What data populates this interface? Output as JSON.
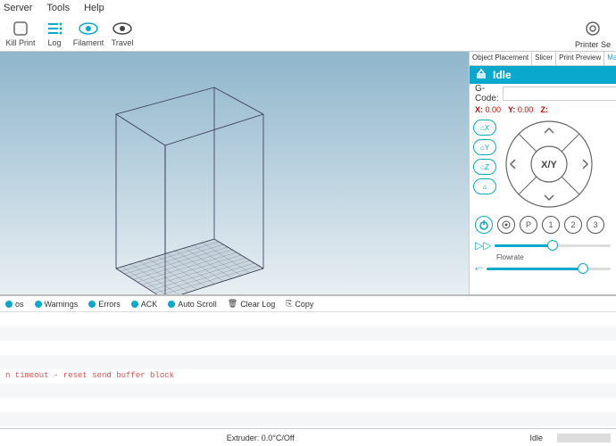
{
  "menu": {
    "items": [
      "Server",
      "Tools",
      "Help"
    ]
  },
  "toolbar": {
    "items": [
      {
        "name": "kill-print",
        "label": "Kill Print"
      },
      {
        "name": "log",
        "label": "Log"
      },
      {
        "name": "filament",
        "label": "Filament"
      },
      {
        "name": "travel",
        "label": "Travel"
      }
    ],
    "right": {
      "label": "Printer Se"
    }
  },
  "side": {
    "tabs": [
      "Object Placement",
      "Slicer",
      "Print Preview",
      "Manual C"
    ],
    "active_tab": 3,
    "status": "Idle",
    "gcode_label": "G-Code:",
    "gcode_value": "",
    "coords": {
      "xlabel": "X:",
      "x": "0.00",
      "ylabel": "Y:",
      "y": "0.00",
      "zlabel": "Z:"
    },
    "home": {
      "x": "X",
      "y": "Y",
      "z": "Z"
    },
    "jog_center": "X/Y",
    "ctrl": {
      "p": "P",
      "one": "1",
      "two": "2",
      "three": "3"
    },
    "flowrate_label": "Flowrate",
    "slider1_pct": 50,
    "slider2_pct": 78
  },
  "log_toolbar": {
    "items": [
      "os",
      "Warnings",
      "Errors",
      "ACK",
      "Auto Scroll"
    ],
    "clear": "Clear Log",
    "copy": "Copy"
  },
  "log_lines": [
    {
      "text": "",
      "err": false
    },
    {
      "text": "",
      "err": false
    },
    {
      "text": "",
      "err": false
    },
    {
      "text": "",
      "err": false
    },
    {
      "text": "n timeout - reset send buffer block",
      "err": true
    },
    {
      "text": "",
      "err": false
    },
    {
      "text": "",
      "err": false
    },
    {
      "text": "",
      "err": false
    }
  ],
  "statusbar": {
    "extruder": "Extruder: 0.0°C/Off",
    "state": "Idle"
  }
}
